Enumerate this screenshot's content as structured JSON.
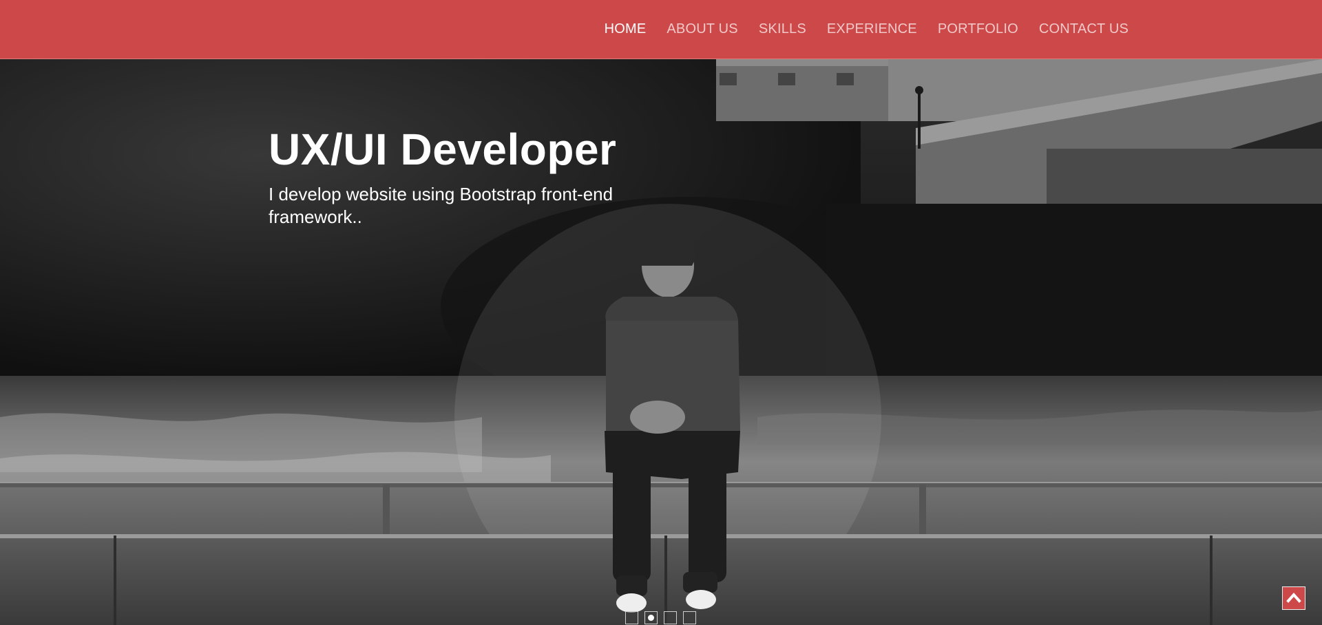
{
  "nav": {
    "items": [
      {
        "label": "HOME",
        "active": true
      },
      {
        "label": "ABOUT US",
        "active": false
      },
      {
        "label": "SKILLS",
        "active": false
      },
      {
        "label": "EXPERIENCE",
        "active": false
      },
      {
        "label": "PORTFOLIO",
        "active": false
      },
      {
        "label": "CONTACT US",
        "active": false
      }
    ]
  },
  "hero": {
    "title": "UX/UI Developer",
    "subtitle": "I develop website using Bootstrap front-end framework..",
    "image_icon": "photo-person-sitting-on-railing",
    "carousel": {
      "count": 4,
      "active_index": 1
    }
  },
  "back_to_top": {
    "icon": "chevron-up-icon"
  },
  "colors": {
    "brand": "#cd4849",
    "nav_text": "#f1c9c9",
    "nav_active": "#ffffff",
    "hero_text": "#ffffff"
  }
}
